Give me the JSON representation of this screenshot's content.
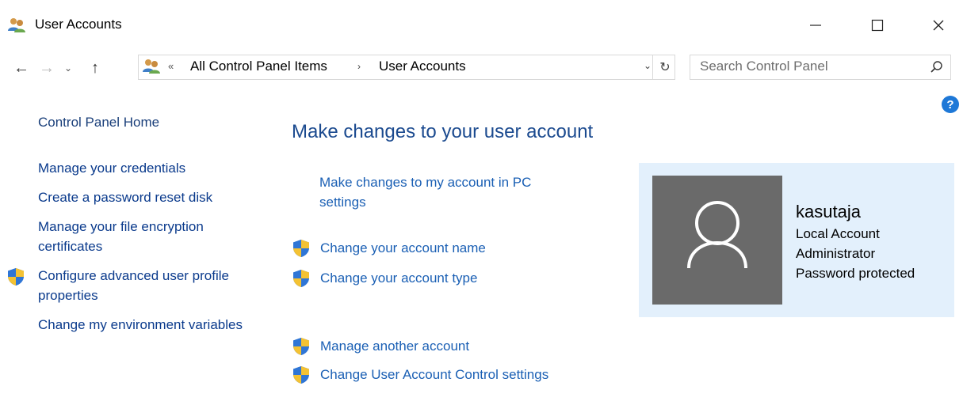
{
  "window": {
    "title": "User Accounts",
    "minimize_glyph": "—",
    "maximize_glyph": "☐",
    "close_glyph": "✕"
  },
  "navigation": {
    "back_glyph": "←",
    "forward_glyph": "→",
    "recent_glyph": "⌄",
    "up_glyph": "↑",
    "address_chevron": "«",
    "breadcrumbs": [
      "All Control Panel Items",
      "User Accounts"
    ],
    "separator": "›",
    "dropdown_glyph": "⌄",
    "refresh_glyph": "↻",
    "search_placeholder": "Search Control Panel"
  },
  "sidebar": {
    "home": "Control Panel Home",
    "links": [
      {
        "label": "Manage your credentials",
        "shield": false
      },
      {
        "label": "Create a password reset disk",
        "shield": false
      },
      {
        "label": "Manage your file encryption certificates",
        "shield": false
      },
      {
        "label": "Configure advanced user profile properties",
        "shield": true
      },
      {
        "label": "Change my environment variables",
        "shield": false
      }
    ]
  },
  "main": {
    "heading": "Make changes to your user account",
    "pc_settings_link": "Make changes to my account in PC settings",
    "tasks": {
      "change_name": "Change your account name",
      "change_type": "Change your account type",
      "manage_another": "Manage another account",
      "uac_settings": "Change User Account Control settings"
    }
  },
  "account": {
    "username": "kasutaja",
    "type": "Local Account",
    "role": "Administrator",
    "password_status": "Password protected"
  },
  "icons": {
    "app": "users-icon",
    "shield": "uac-shield-icon",
    "help": "help-icon",
    "search": "search-icon",
    "avatar": "user-silhouette-icon"
  },
  "colors": {
    "link": "#1a5fb4",
    "heading": "#1b4a8f",
    "card_bg": "#e3f0fc",
    "avatar_bg": "#6a6a6a",
    "help": "#1e78d7"
  }
}
